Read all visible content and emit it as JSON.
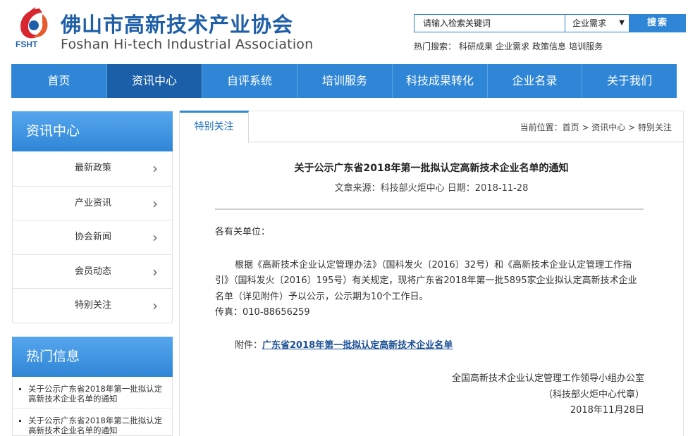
{
  "header": {
    "logo_abbr": "FSHT",
    "org_name_cn": "佛山市高新技术产业协会",
    "org_name_en": "Foshan Hi-tech Industrial Association"
  },
  "search": {
    "placeholder": "请输入检索关键词",
    "category": "企业需求",
    "button": "搜索",
    "hot_label": "热门搜索：",
    "hot_terms": [
      "科研成果",
      "企业需求",
      "政策信息",
      "培训服务"
    ]
  },
  "nav": {
    "items": [
      "首页",
      "资讯中心",
      "自评系统",
      "培训服务",
      "科技成果转化",
      "企业名录",
      "关于我们"
    ],
    "active": "资讯中心"
  },
  "sidebar": {
    "title": "资讯中心",
    "items": [
      "最新政策",
      "产业资讯",
      "协会新闻",
      "会员动态",
      "特别关注"
    ],
    "hot_title": "热门信息",
    "hot_items": [
      "关于公示广东省2018年第一批拟认定高新技术企业名单的通知",
      "关于公示广东省2018年第二批拟认定高新技术企业名单的通知"
    ]
  },
  "main": {
    "tab": "特别关注",
    "breadcrumb": "当前位置：首页 > 资讯中心 > 特别关注",
    "article": {
      "title": "关于公示广东省2018年第一批拟认定高新技术企业名单的通知",
      "meta": "文章来源：科技部火炬中心 日期：2018-11-28",
      "salutation": "各有关单位：",
      "body_line1": "根据《高新技术企业认定管理办法》（国科发火〔2016〕32号）和《高新技术企业认定管理工作指",
      "body_line2": "引》（国科发火〔2016〕195号）有关规定，现将广东省2018年第一批5895家企业拟认定高新技术企业",
      "body_line3": "名单（详见附件）予以公示，公示期为10个工作日。",
      "fax": "传真：010-88656259",
      "attachment_label": "附件：",
      "attachment_link": "广东省2018年第一批拟认定高新技术企业名单",
      "signature_org": "全国高新技术企业认定管理工作领导小组办公室",
      "signature_proxy": "（科技部火炬中心代章）",
      "signature_date": "2018年11月28日"
    }
  },
  "colors": {
    "primary": "#2f86d6",
    "active_nav": "#1a5fa8",
    "logo_text": "#1f5fa8",
    "logo_red": "#d7262f"
  }
}
